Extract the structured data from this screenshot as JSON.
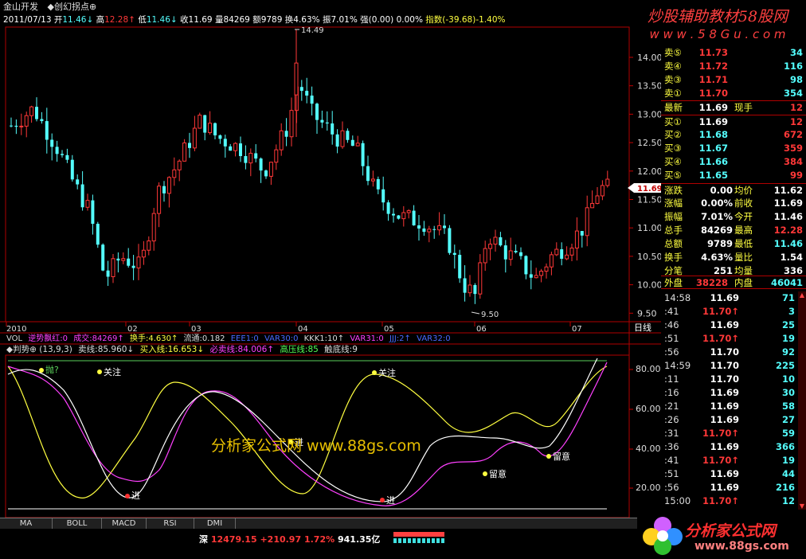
{
  "window": {
    "title_app": "金山开发",
    "title_formula": "◆创幻拐点⊕"
  },
  "infobar": {
    "date": "2011/07/13",
    "open_label": "开",
    "open": "11.46",
    "high_label": "高",
    "high": "12.28",
    "low_label": "低",
    "low": "11.46",
    "close_label": "收",
    "close": "11.69",
    "vol_label": "量",
    "vol": "84269",
    "amt_label": "额",
    "amt": "9789",
    "turnover_label": "换",
    "turnover": "4.63%",
    "amp_label": "振",
    "amp": "7.01%",
    "strong_label": "强",
    "strong": "(0.00)",
    "strong_pct": "0.00%",
    "index_label": "指数",
    "index": "(-39.68)-1.40%"
  },
  "price_axis": {
    "ticks": [
      "14.00",
      "13.50",
      "13.00",
      "12.50",
      "12.00",
      "11.50",
      "11.00",
      "10.50",
      "10.00",
      "9.50"
    ],
    "current": "11.69",
    "max_label": "14.49",
    "min_label": "9.50"
  },
  "date_axis": {
    "labels": [
      "2010",
      "02",
      "03",
      "04",
      "05",
      "06",
      "07"
    ],
    "period": "日线"
  },
  "vol_bar": {
    "text1": "VOL",
    "text2": "逆势飘红:0",
    "text3": "成交:84269↑",
    "text4": "换手:4.630↑",
    "text5": "流通:0.182",
    "text6": "EEE1:0",
    "text7": "VAR30:0",
    "text8": "KKK1:10↑",
    "text9": "VAR31:0",
    "text10": "JJJ:2↑",
    "text11": "VAR32:0"
  },
  "osc_bar": {
    "name": "◆判势⊕",
    "params": "(13,9,3)",
    "sell": "卖线:85.960↓",
    "buy": "买入线:16.653↓",
    "must": "必卖线:84.006↑",
    "high": "高压线:85",
    "bottom": "触底线:9"
  },
  "osc_axis": {
    "ticks": [
      "80.00",
      "60.00",
      "40.00",
      "20.00"
    ]
  },
  "osc_labels": {
    "stop": "抛?",
    "focus1": "关注",
    "focus2": "关注",
    "in1": "进",
    "in2": "进",
    "stay1": "留意",
    "stay2": "留意",
    "jin": "进"
  },
  "watermarks": {
    "top1": "炒股辅助教材58股网",
    "top2": "w w w . 5 8 G u . c o m",
    "mid": "分析家公式网  www.88gs.com",
    "logo1": "分析家公式网",
    "logo2": "www.88gs.com"
  },
  "quote": {
    "sell": [
      {
        "l": "卖⑤",
        "p": "11.73",
        "v": "34"
      },
      {
        "l": "卖④",
        "p": "11.72",
        "v": "116"
      },
      {
        "l": "卖③",
        "p": "11.71",
        "v": "98"
      },
      {
        "l": "卖①",
        "p": "11.70",
        "v": "354"
      }
    ],
    "latest_l": "最新",
    "latest": "11.69",
    "now_hand_l": "现手",
    "now_hand": "12",
    "buy": [
      {
        "l": "买①",
        "p": "11.69",
        "v": "12"
      },
      {
        "l": "买②",
        "p": "11.68",
        "v": "672"
      },
      {
        "l": "买③",
        "p": "11.67",
        "v": "359"
      },
      {
        "l": "买④",
        "p": "11.66",
        "v": "384"
      },
      {
        "l": "买⑤",
        "p": "11.65",
        "v": "99"
      }
    ],
    "stats": [
      {
        "a": "涨跌",
        "b": "0.00",
        "c": "均价",
        "d": "11.62"
      },
      {
        "a": "涨幅",
        "b": "0.00%",
        "c": "前收",
        "d": "11.69"
      },
      {
        "a": "振幅",
        "b": "7.01%",
        "c": "今开",
        "d": "11.46"
      },
      {
        "a": "总手",
        "b": "84269",
        "c": "最高",
        "d": "12.28"
      },
      {
        "a": "总额",
        "b": "9789",
        "c": "最低",
        "d": "11.46"
      },
      {
        "a": "换手",
        "b": "4.63%",
        "c": "量比",
        "d": "1.54"
      },
      {
        "a": "分笔",
        "b": "251",
        "c": "均量",
        "d": "336"
      }
    ],
    "out_l": "外盘",
    "out": "38228",
    "in_l": "内盘",
    "in": "46041"
  },
  "ticks": [
    {
      "t": "14:58",
      "p": "11.69",
      "v": "71"
    },
    {
      "t": ":41",
      "p": "11.70↑",
      "v": "3"
    },
    {
      "t": ":46",
      "p": "11.69",
      "v": "25"
    },
    {
      "t": ":51",
      "p": "11.70↑",
      "v": "19"
    },
    {
      "t": ":56",
      "p": "11.70",
      "v": "92"
    },
    {
      "t": "14:59",
      "p": "11.70",
      "v": "225"
    },
    {
      "t": ":11",
      "p": "11.70",
      "v": "10"
    },
    {
      "t": ":16",
      "p": "11.69",
      "v": "30"
    },
    {
      "t": ":21",
      "p": "11.69",
      "v": "58"
    },
    {
      "t": ":26",
      "p": "11.69",
      "v": "27"
    },
    {
      "t": ":31",
      "p": "11.70↑",
      "v": "59"
    },
    {
      "t": ":36",
      "p": "11.69",
      "v": "366"
    },
    {
      "t": ":41",
      "p": "11.70↑",
      "v": "19"
    },
    {
      "t": ":51",
      "p": "11.69",
      "v": "44"
    },
    {
      "t": ":56",
      "p": "11.69",
      "v": "216"
    },
    {
      "t": "15:00",
      "p": "11.70↑",
      "v": "12"
    }
  ],
  "tabs": [
    "MA",
    "BOLL",
    "MACD",
    "RSI",
    "DMI"
  ],
  "status": {
    "market": "深",
    "index": "12479.15",
    "chg": "+210.97",
    "pct": "1.72%",
    "amount": "941.35亿"
  },
  "colors": {
    "up": "#ff3838",
    "down": "#54ffff",
    "frame": "#c00000"
  }
}
